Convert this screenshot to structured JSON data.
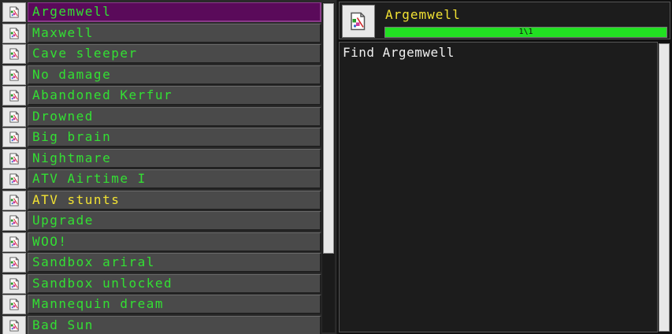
{
  "achievements": [
    {
      "label": "Argemwell",
      "state": "selected"
    },
    {
      "label": "Maxwell",
      "state": "normal"
    },
    {
      "label": "Cave sleeper",
      "state": "normal"
    },
    {
      "label": "No damage",
      "state": "normal"
    },
    {
      "label": "Abandoned Kerfur",
      "state": "normal"
    },
    {
      "label": "Drowned",
      "state": "normal"
    },
    {
      "label": "Big brain",
      "state": "normal"
    },
    {
      "label": "Nightmare",
      "state": "normal"
    },
    {
      "label": "ATV Airtime I",
      "state": "normal"
    },
    {
      "label": "ATV stunts",
      "state": "highlight"
    },
    {
      "label": "Upgrade",
      "state": "normal"
    },
    {
      "label": "WOO!",
      "state": "normal"
    },
    {
      "label": "Sandbox ariral",
      "state": "normal"
    },
    {
      "label": "Sandbox unlocked",
      "state": "normal"
    },
    {
      "label": "Mannequin dream",
      "state": "normal"
    },
    {
      "label": "Bad Sun",
      "state": "normal"
    }
  ],
  "detail": {
    "title": "Argemwell",
    "progress_text": "1\\1",
    "progress_fraction": 1.0,
    "description": "Find Argemwell"
  },
  "icons": {
    "row_icon": "broken-image-icon",
    "header_icon": "broken-image-icon"
  },
  "colors": {
    "label_green": "#33e033",
    "label_yellow": "#f2e233",
    "selected_row": "#5a0a5a",
    "progress_fill": "#22e022"
  }
}
